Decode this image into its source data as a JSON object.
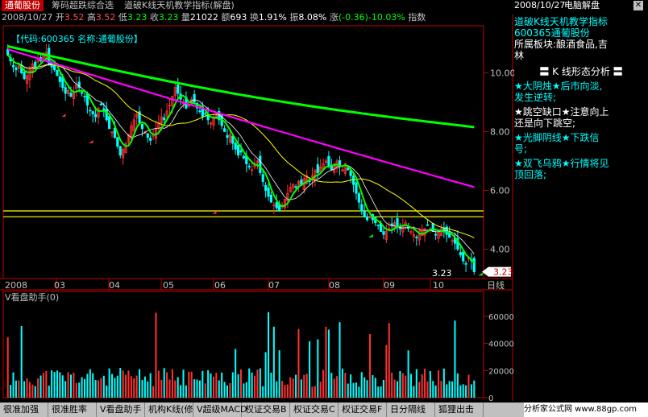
{
  "title_bar": {
    "stock_name": "通葡股份",
    "menu_items": [
      "筹码超跌综合选",
      "道破K线天机教学指标(解盘)"
    ],
    "date": "2008/10/27",
    "app_name": "电脑解盘"
  },
  "quote_line": {
    "open_label": "开",
    "open": "3.52",
    "high_label": "高",
    "high": "3.52",
    "low_label": "低",
    "low": "3.23",
    "close_label": "收",
    "close": "3.23",
    "volume_label": "量",
    "volume": "21022",
    "amount_label": "额",
    "amount": "693",
    "turnover_label": "换",
    "turnover": "1.91%",
    "amplitude_label": "振",
    "amplitude": "8.08%",
    "change_label": "涨",
    "change": "(-0.36)-10.03%",
    "index_label": "指数"
  },
  "price_chart": {
    "legend": "【代码:600365 名称:通葡股份】",
    "y_ticks": [
      "10.00",
      "8.00",
      "6.00",
      "4.00"
    ],
    "x_ticks": [
      "2008",
      "03",
      "04",
      "05",
      "06",
      "07",
      "08",
      "09",
      "10"
    ],
    "period_label": "日线",
    "last_price_tag": "3.23",
    "low_label": "3.23"
  },
  "volume_chart": {
    "title": "V看盘助手(0)",
    "y_ticks": [
      "60000",
      "40000",
      "20000",
      "0"
    ]
  },
  "side_panel": {
    "date": "2008/10/27",
    "indicator_name": "道破K线天机教学指标",
    "stock_line": "600365通葡股份",
    "sector_line1": "所属板块:酿酒食品,吉",
    "sector_line2": "林",
    "section_title": "K 线形态分析",
    "items": [
      {
        "text1": "★大阴烛★后市向淡,",
        "text2": "发生逆转;",
        "color": "#00ffff"
      },
      {
        "text1": "★跳空缺口★注意向上",
        "text2": "还是向下跳空;",
        "color": "#ffffff"
      },
      {
        "text1": "★光脚阴线★下跌信",
        "text2": "号;",
        "color": "#00ffff"
      },
      {
        "text1": "★双飞乌鸦★行情将见",
        "text2": "顶回落;",
        "color": "#00ffff"
      }
    ]
  },
  "bottom_tabs": [
    "很准加强",
    "很准胜率",
    "V看盘助手",
    "机构K线(修",
    "V超级MACD",
    "权证交易B",
    "权证交易C",
    "权证交易F",
    "日分隔线",
    "狐狸出击"
  ],
  "website": "分析家公式网 www.88gp.com",
  "colors": {
    "up": "#ff3030",
    "down": "#00ffff",
    "ma_green": "#00ff00",
    "ma_magenta": "#ff00ff",
    "ma_yellow": "#ffff00",
    "axis": "#c00000"
  },
  "chart_data": {
    "type": "candlestick",
    "x_axis_months": [
      "2008",
      "03",
      "04",
      "05",
      "06",
      "07",
      "08",
      "09",
      "10"
    ],
    "ylim": [
      3.0,
      11.6
    ],
    "close_series": [
      10.6,
      10.4,
      10.2,
      10.1,
      10.3,
      10.0,
      9.8,
      9.9,
      10.1,
      10.3,
      10.2,
      10.5,
      10.4,
      10.6,
      10.7,
      10.3,
      10.2,
      10.1,
      9.9,
      9.7,
      9.5,
      9.3,
      9.4,
      9.2,
      9.3,
      9.6,
      9.5,
      9.3,
      9.2,
      8.9,
      8.7,
      8.6,
      8.5,
      8.8,
      8.9,
      8.7,
      8.4,
      8.1,
      8.0,
      7.8,
      7.5,
      7.2,
      7.4,
      7.6,
      7.9,
      8.2,
      8.4,
      8.6,
      8.3,
      8.1,
      8.0,
      7.8,
      7.7,
      7.9,
      8.1,
      8.3,
      8.5,
      8.4,
      8.7,
      8.9,
      9.2,
      9.5,
      9.3,
      9.1,
      9.0,
      8.8,
      8.9,
      9.1,
      9.0,
      8.8,
      8.7,
      8.5,
      8.6,
      8.4,
      8.3,
      8.5,
      8.6,
      8.4,
      8.2,
      8.0,
      7.8,
      7.9,
      7.6,
      7.4,
      7.2,
      7.3,
      7.1,
      6.9,
      6.8,
      6.7,
      6.9,
      7.0,
      6.6,
      6.3,
      6.0,
      5.8,
      5.6,
      5.5,
      5.4,
      5.3,
      5.5,
      5.7,
      5.9,
      6.1,
      6.2,
      6.1,
      6.3,
      6.2,
      6.4,
      6.5,
      6.3,
      6.5,
      6.7,
      6.6,
      6.8,
      6.9,
      7.0,
      6.8,
      6.7,
      6.9,
      7.0,
      6.8,
      6.7,
      6.9,
      6.7,
      6.5,
      6.2,
      5.9,
      5.6,
      5.3,
      5.1,
      5.0,
      5.1,
      5.0,
      4.9,
      4.8,
      4.6,
      4.5,
      4.6,
      4.7,
      4.8,
      4.9,
      4.8,
      4.7,
      4.8,
      4.9,
      4.7,
      4.6,
      4.5,
      4.4,
      4.5,
      4.6,
      4.7,
      4.8,
      4.7,
      4.6,
      4.5,
      4.6,
      4.7,
      4.6,
      4.5,
      4.4,
      4.3,
      4.2,
      4.0,
      3.8,
      3.6,
      3.5,
      3.7,
      3.6,
      3.23
    ],
    "ma_green_last": 3.95,
    "ma_magenta_last": 6.25,
    "ma_green_long_last": 8.2,
    "horizontal_lines": [
      5.3,
      5.1
    ]
  }
}
